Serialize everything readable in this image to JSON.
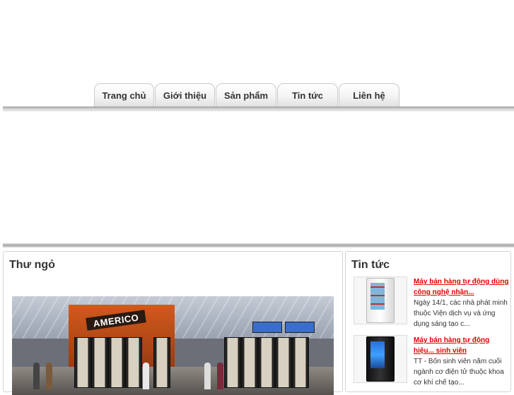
{
  "nav": {
    "tabs": [
      {
        "label": "Trang chủ"
      },
      {
        "label": "Giới thiệu"
      },
      {
        "label": "Sản phẩm"
      },
      {
        "label": "Tin tức"
      },
      {
        "label": "Liên hệ"
      }
    ]
  },
  "intro": {
    "title": "Thư ngỏ",
    "image_brand": "AMERICO"
  },
  "news": {
    "title": "Tin tức",
    "items": [
      {
        "title": "Máy bán hàng tự động dùng công nghệ nhận...",
        "desc": "Ngày 14/1, các nhà phát minh thuộc Viện dịch vụ và ứng dụng sáng tạo c...",
        "thumb_icon": "vending-machine-icon"
      },
      {
        "title": "Máy bán hàng tự động hiệu... sinh viên",
        "desc": "TT - Bốn sinh viên năm cuối ngành cơ điện tử thuộc khoa cơ khí chế tạo...",
        "thumb_icon": "vending-machine-icon"
      }
    ]
  },
  "colors": {
    "news_title": "#e00000",
    "text": "#333333",
    "border": "#d4d4d4"
  }
}
